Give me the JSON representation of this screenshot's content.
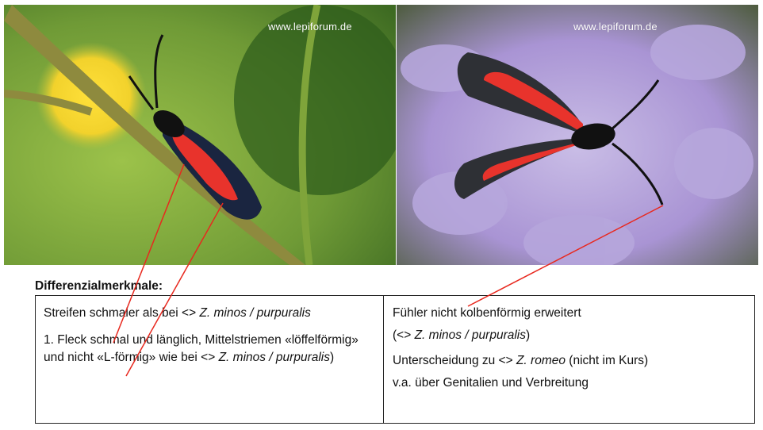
{
  "photos": {
    "left_watermark": "www.lepiforum.de",
    "right_watermark": "www.lepiforum.de"
  },
  "heading": "Differenzialmerkmale:",
  "table": {
    "left": {
      "line1_text": "Streifen schmaler als bei <> ",
      "line1_italic": "Z. minos / purpuralis",
      "line2_text": "1. Fleck schmal und länglich, Mittelstriemen «löffelförmig» und nicht «L-förmig» wie bei <> ",
      "line2_italic": "Z. minos / purpuralis",
      "line2_end": ")"
    },
    "right": {
      "line1_text": "Fühler nicht kolbenförmig erweitert",
      "line2_open": "(<> ",
      "line2_italic": "Z. minos / purpuralis",
      "line2_close": ")",
      "line3_text": "Unterscheidung zu <> ",
      "line3_italic": "Z. romeo",
      "line3_end": " (nicht im Kurs)",
      "line4_text": "v.a. über Genitalien und Verbreitung"
    }
  },
  "colors": {
    "pointer_line": "#e8281e",
    "moth_red": "#e8332c",
    "flower": "#b4a3d9"
  }
}
